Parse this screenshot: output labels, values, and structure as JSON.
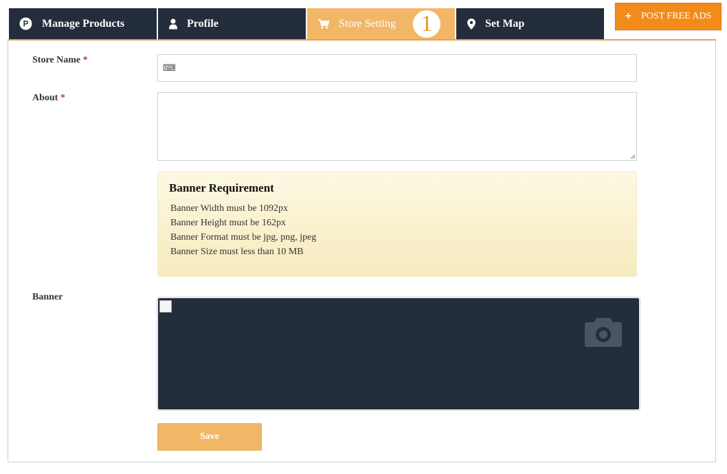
{
  "tabs": [
    {
      "label": "Manage Products",
      "icon": "product-p-icon"
    },
    {
      "label": "Profile",
      "icon": "user-icon"
    },
    {
      "label": "Store Setting",
      "icon": "cart-icon",
      "badge": "1",
      "active": true
    },
    {
      "label": "Set Map",
      "icon": "map-marker-icon"
    }
  ],
  "post_ads": {
    "label": "POST FREE ADS",
    "icon": "plus-icon"
  },
  "form": {
    "store_name_label": "Store Name",
    "about_label": "About",
    "required_mark": "*",
    "store_name_value": "",
    "about_value": "",
    "banner_label": "Banner",
    "save_label": "Save"
  },
  "banner_requirement": {
    "title": "Banner Requirement",
    "lines": [
      "Banner Width must be 1092px",
      "Banner Height must be 162px",
      "Banner Format must be jpg, png, jpeg",
      "Banner Size must less than 10 MB"
    ]
  },
  "colors": {
    "nav_bg": "#232d3c",
    "active_tab": "#f2b766",
    "post_ads": "#f28b1a",
    "notice_bg": "#fcf8e3",
    "required": "#c0392b"
  }
}
